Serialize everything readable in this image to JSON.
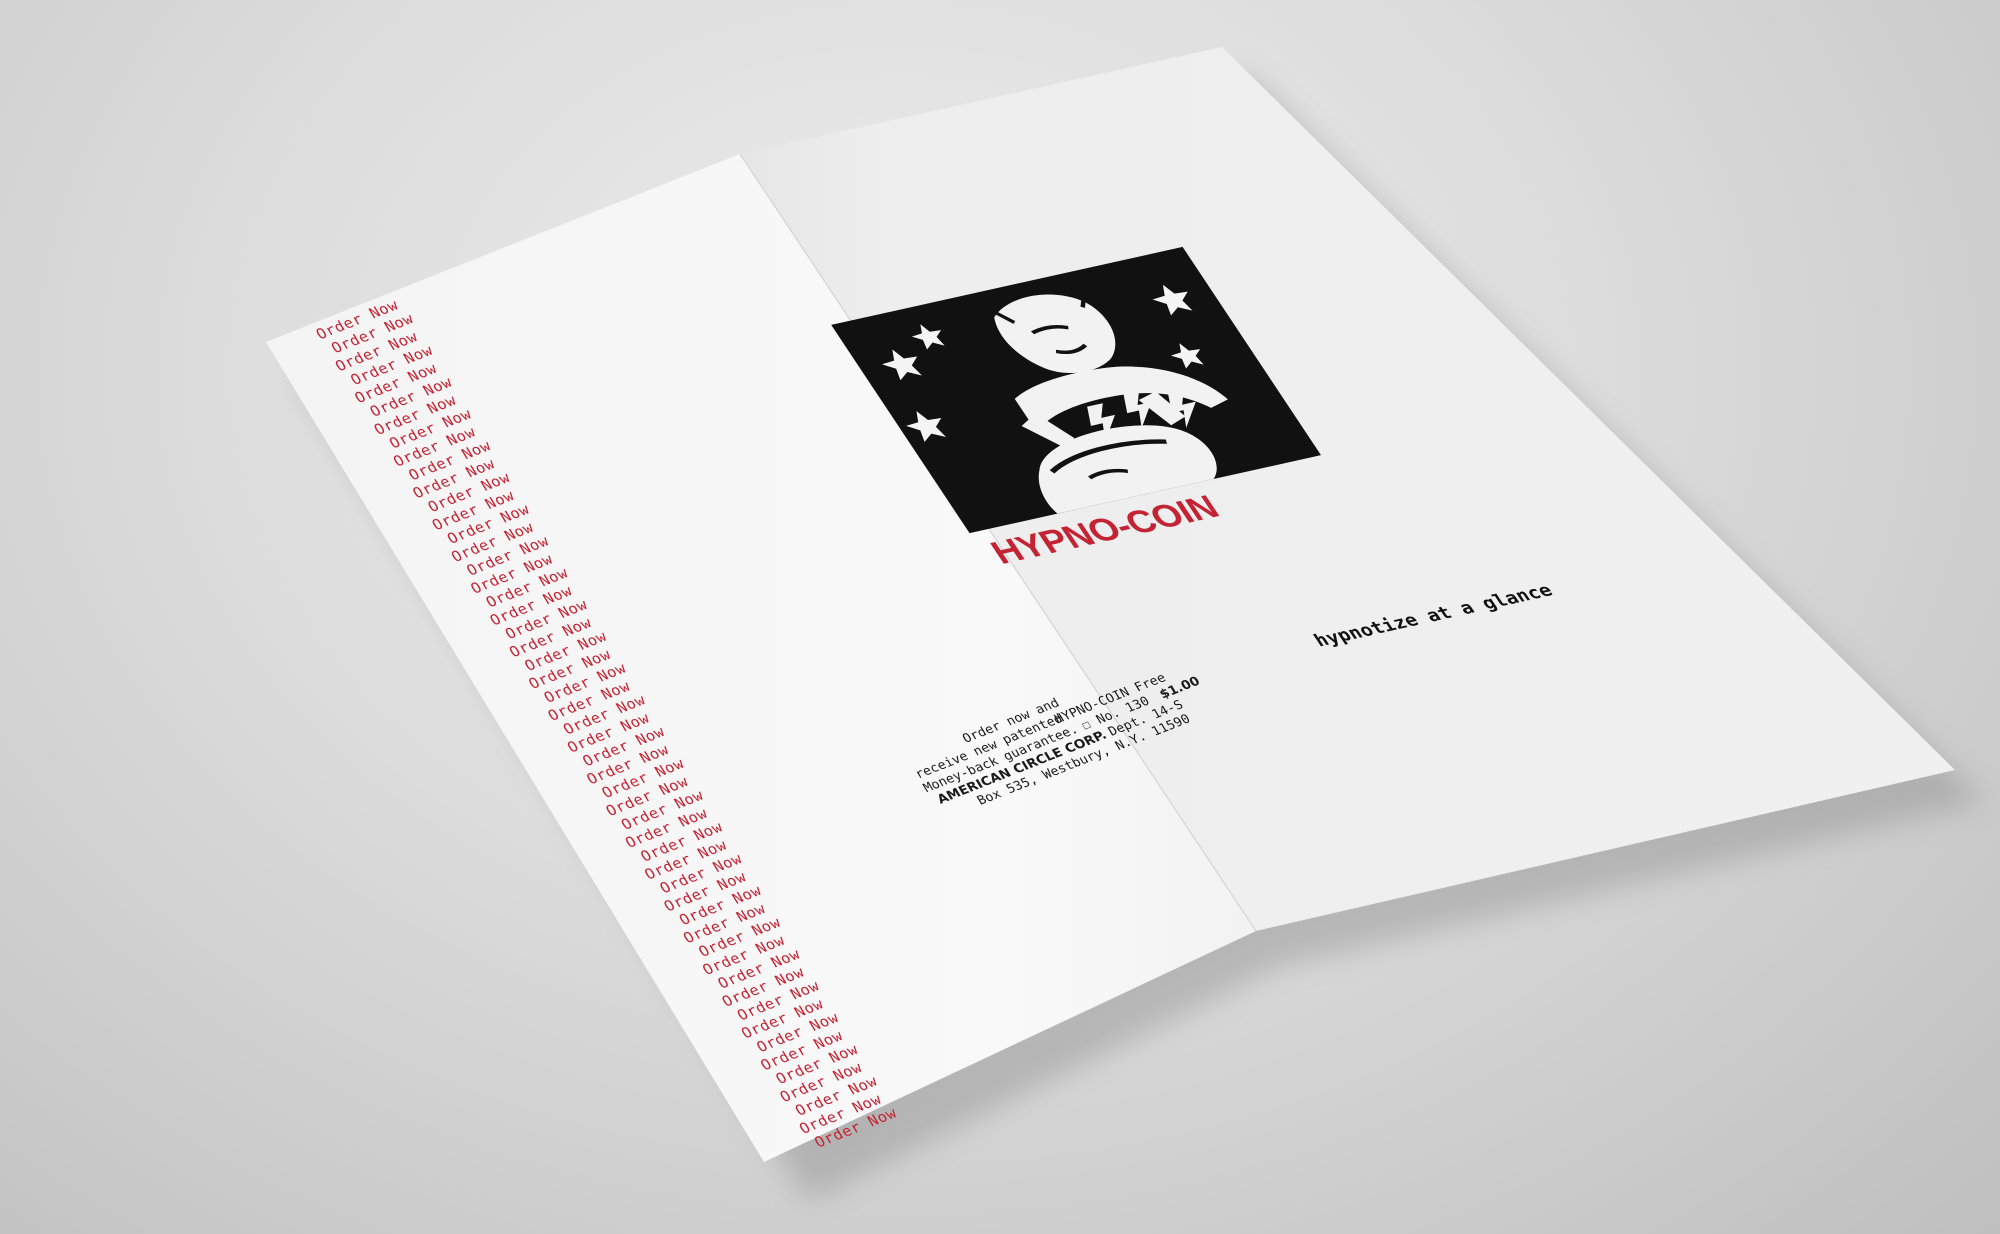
{
  "brochure": {
    "left_panel": {
      "repeated_text": "Order Now",
      "repeat_count": 52,
      "offer": {
        "line1": "Order now and",
        "line2_a": "receive new patented",
        "line2_b": "HYPNO-COIN Free",
        "line3": "Money-back guarantee.",
        "line3_checkbox": "☐",
        "line3_number": "No. 130",
        "line3_price": "$1.00",
        "line4_company": "AMERICAN CIRCLE CORP.",
        "line4_dept": "Dept. 14-S",
        "line5": "Box 535, Westbury, N.Y. 11590"
      }
    },
    "right_panel": {
      "brand": "HYPNO-COIN",
      "tagline": "hypnotize at a glance",
      "illustration": "hypnotist-woodcut-illustration"
    }
  },
  "colors": {
    "accent_red": "#c42333",
    "ink_black": "#111111",
    "paper_left": "#f7f7f7",
    "paper_right": "#eeeeee",
    "background": "#d6d6d6"
  }
}
